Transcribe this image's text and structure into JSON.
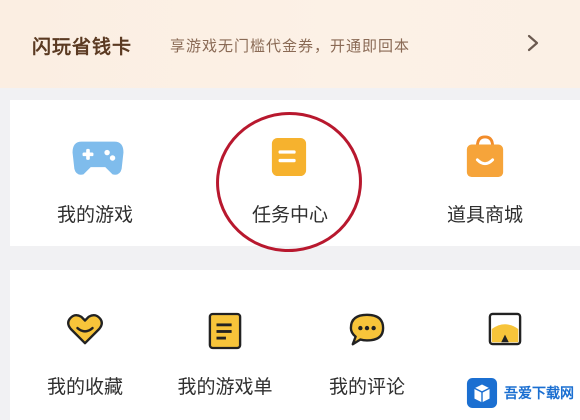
{
  "banner": {
    "brand": "闪玩省钱卡",
    "description": "享游戏无门槛代金券，开通即回本",
    "chevron_icon": "chevron-right-icon"
  },
  "top_grid": {
    "items": [
      {
        "label": "我的游戏",
        "icon": "gamepad-icon"
      },
      {
        "label": "任务中心",
        "icon": "task-note-icon"
      },
      {
        "label": "道具商城",
        "icon": "shopping-bag-icon"
      }
    ]
  },
  "bottom_grid": {
    "items": [
      {
        "label": "我的收藏",
        "icon": "heart-icon"
      },
      {
        "label": "我的游戏单",
        "icon": "list-note-icon"
      },
      {
        "label": "我的评论",
        "icon": "comment-bubble-icon"
      },
      {
        "label": "",
        "icon": "picture-frame-icon"
      }
    ]
  },
  "watermark": {
    "text": "吾爱下载网"
  },
  "colors": {
    "banner_bg": "#fbeee2",
    "accent_yellow": "#f7b731",
    "accent_blue": "#6fb4ea",
    "accent_orange": "#f5a03c",
    "highlight_circle": "#b8182e",
    "watermark_blue": "#1b6fd1"
  }
}
